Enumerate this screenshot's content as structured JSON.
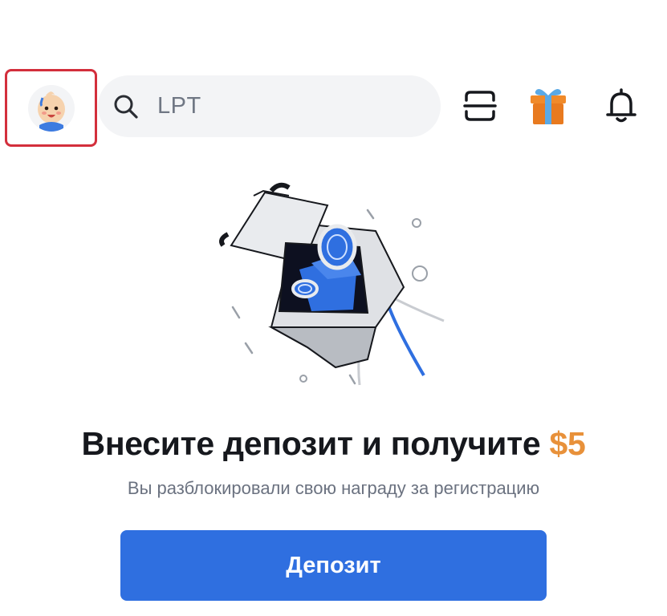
{
  "header": {
    "avatar": {
      "icon": "baby-avatar-icon"
    },
    "search": {
      "value": "LPT",
      "icon": "search-icon"
    },
    "actions": [
      {
        "icon": "scan-icon"
      },
      {
        "icon": "gift-icon"
      },
      {
        "icon": "bell-icon"
      }
    ]
  },
  "promo": {
    "illustration": "gift-box-coins-illustration",
    "headline": "Внесите депозит и получите",
    "amount": "$5",
    "subtitle": "Вы разблокировали свою награду за регистрацию",
    "button_label": "Депозит"
  },
  "colors": {
    "accent": "#2f6fe0",
    "amount": "#e8913a",
    "highlight_border": "#d32f3c"
  }
}
